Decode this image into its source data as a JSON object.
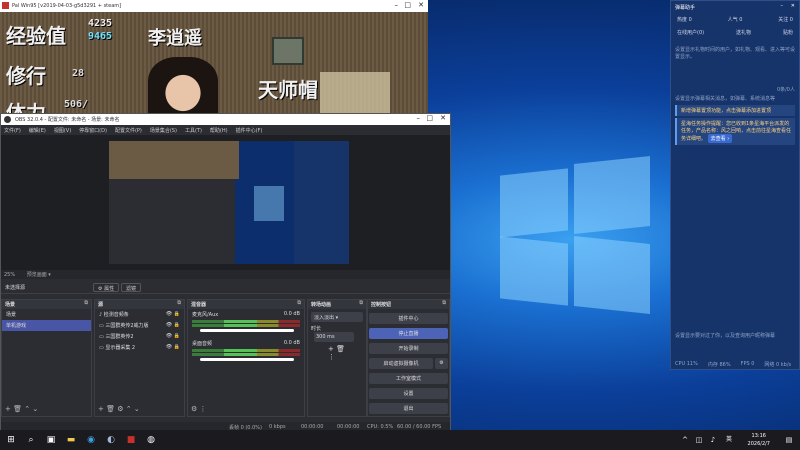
{
  "game": {
    "title": "Pal Win95 [v2019-04-03-g5d3291 + steam]",
    "exp_label": "经验值",
    "exp_cur": "4235",
    "exp_next": "9465",
    "name": "李逍遥",
    "level_label": "修行",
    "level": "28",
    "hp_label": "体力",
    "hp": "506/",
    "item": "天师帽"
  },
  "obs": {
    "title": "OBS 32.0.4 - 配置文件: 未命名 - 场景: 未命名",
    "menu": [
      "文件(F)",
      "编辑(E)",
      "视图(V)",
      "停靠窗口(D)",
      "配置文件(P)",
      "场景集合(S)",
      "工具(T)",
      "帮助(H)",
      "插件中心(F)"
    ],
    "zoom": "25%",
    "preview_mode": "预览画面 ▾",
    "no_source": "未选择源",
    "properties": "⚙ 属性",
    "filters": "滤镜",
    "scenes_title": "场景",
    "scenes": [
      "场景",
      "单机游戏"
    ],
    "sources_title": "源",
    "sources": [
      "检测音频条",
      "三国群英传2威力版",
      "三国群英传2",
      "显示器采集 2"
    ],
    "mixer_title": "混音器",
    "mixer": [
      {
        "name": "麦克风/Aux",
        "db": "0.0 dB"
      },
      {
        "name": "桌面音频",
        "db": "0.0 dB"
      }
    ],
    "transitions_title": "转场动画",
    "transition": "淡入淡出",
    "duration_label": "时长",
    "duration": "300 ms",
    "controls_title": "控制按钮",
    "controls": {
      "plugin_center": "插件中心",
      "stop_stream": "停止直播",
      "start_record": "开始录制",
      "virtual_cam": "启动虚拟摄像机",
      "studio_mode": "工作室模式",
      "settings": "设置",
      "exit": "退出"
    },
    "status": {
      "dropped": "丢帧 0 (0.0%)",
      "kbps": "0 kbps",
      "rec_time": "00:00:00",
      "stream_time": "00:00:00",
      "cpu": "CPU: 0.5%",
      "fps": "60.00 / 60.00 FPS"
    }
  },
  "panel": {
    "title": "弹幕助手",
    "stats": [
      {
        "label": "热度 0"
      },
      {
        "label": "人气 0"
      },
      {
        "label": "关注 0"
      }
    ],
    "tabs": [
      "在线用户(0)",
      "送礼物",
      "贴粉"
    ],
    "hint1": "设置显示礼物时间的用户，如礼物、观看、进入等可设置显示。",
    "hint2": "设置显示弹幕相关消息，如弹幕、系统消息等",
    "counter": "0条/0人",
    "notice1": "新增弹幕置顶功能，点击弹幕添加进置顶",
    "notice2": "星海任务操作提醒：您已收到1条星海平台派发的任务，产品名称：风之回响，点击前往星海查看任务详细吧。",
    "go_label": "去查看 ›",
    "hint3": "设置显示要对过了你，以及查询用户昵称弹幕",
    "footer": [
      "CPU 11%",
      "内存 86%",
      "FPS 0",
      "网络 0 kb/s"
    ]
  },
  "taskbar": {
    "time": "13:16",
    "date": "2026/2/7",
    "lang": "英"
  }
}
